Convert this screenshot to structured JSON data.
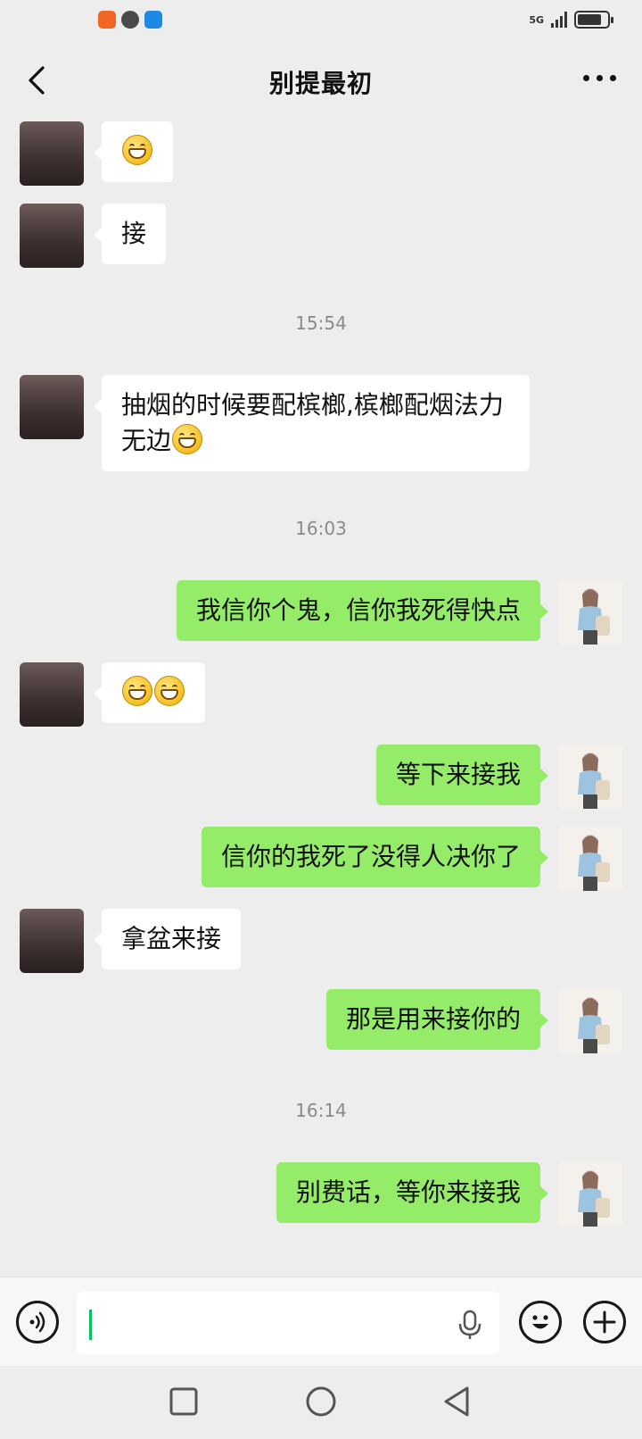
{
  "status_bar": {
    "network": "5G",
    "battery_level": 0.8,
    "app_icons": [
      "taobao-icon",
      "chat-bubble-icon",
      "mail-icon"
    ]
  },
  "header": {
    "title": "别提最初",
    "back_icon": "chevron-left-icon",
    "more_icon": "more-dots-icon"
  },
  "messages": [
    {
      "side": "in",
      "text": "",
      "emoji_count": 1
    },
    {
      "side": "in",
      "text": "接",
      "emoji_count": 0
    },
    {
      "type": "time",
      "text": "15:54"
    },
    {
      "side": "in",
      "text": "抽烟的时候要配槟榔,槟榔配烟法力无边",
      "emoji_count": 1
    },
    {
      "type": "time",
      "text": "16:03"
    },
    {
      "side": "out",
      "text": "我信你个鬼，信你我死得快点",
      "emoji_count": 0
    },
    {
      "side": "in",
      "text": "",
      "emoji_count": 2
    },
    {
      "side": "out",
      "text": "等下来接我",
      "emoji_count": 0
    },
    {
      "side": "out",
      "text": "信你的我死了没得人决你了",
      "emoji_count": 0
    },
    {
      "side": "in",
      "text": "拿盆来接",
      "emoji_count": 0
    },
    {
      "side": "out",
      "text": "那是用来接你的",
      "emoji_count": 0
    },
    {
      "type": "time",
      "text": "16:14"
    },
    {
      "side": "out",
      "text": "别费话，等你来接我",
      "emoji_count": 0
    }
  ],
  "input_bar": {
    "value": "",
    "voice_icon": "voice-icon",
    "mic_icon": "microphone-icon",
    "emoji_icon": "smiley-icon",
    "plus_icon": "plus-icon"
  },
  "nav_bar": {
    "icons": [
      "recent-apps-icon",
      "home-icon",
      "back-triangle-icon"
    ]
  },
  "colors": {
    "background": "#ededed",
    "outgoing_bubble": "#95ec69",
    "incoming_bubble": "#ffffff",
    "timestamp": "#8a8a8a",
    "caret": "#07c160"
  }
}
